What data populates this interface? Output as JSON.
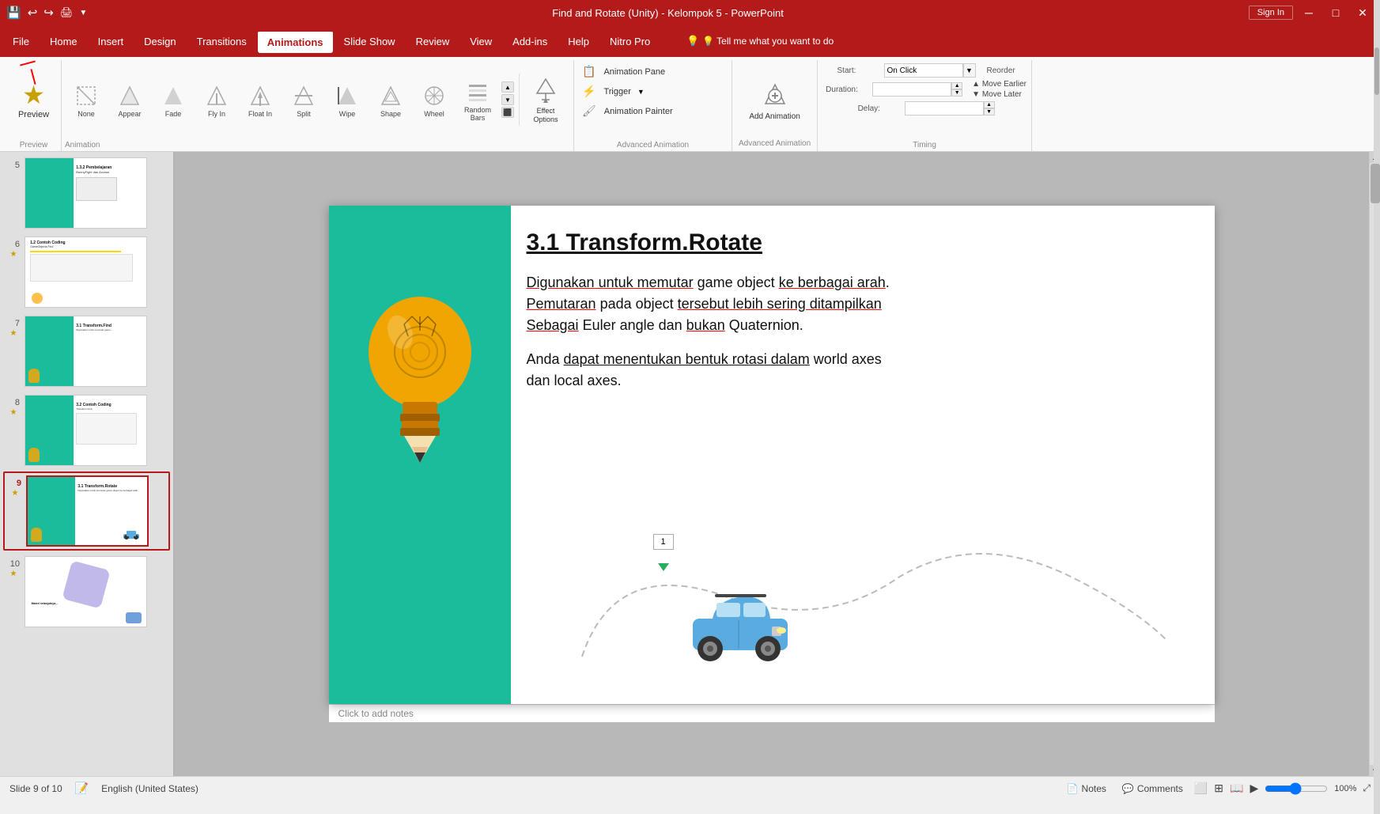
{
  "titlebar": {
    "title": "Find and Rotate (Unity) - Kelompok 5 - PowerPoint",
    "sign_in": "Sign In",
    "quickaccess": [
      "💾",
      "↩",
      "↪",
      "🖨",
      "▼"
    ]
  },
  "menubar": {
    "items": [
      {
        "label": "File",
        "active": false
      },
      {
        "label": "Home",
        "active": false
      },
      {
        "label": "Insert",
        "active": false
      },
      {
        "label": "Design",
        "active": false
      },
      {
        "label": "Transitions",
        "active": false
      },
      {
        "label": "Animations",
        "active": true
      },
      {
        "label": "Slide Show",
        "active": false
      },
      {
        "label": "Review",
        "active": false
      },
      {
        "label": "View",
        "active": false
      },
      {
        "label": "Add-ins",
        "active": false
      },
      {
        "label": "Help",
        "active": false
      },
      {
        "label": "Nitro Pro",
        "active": false
      },
      {
        "label": "💡 Tell me what you want to do",
        "active": false
      }
    ]
  },
  "ribbon": {
    "preview_label": "Preview",
    "animation_group_label": "Animation",
    "advanced_group_label": "Advanced Animation",
    "timing_group_label": "Timing",
    "animations": [
      {
        "label": "None",
        "icon": "✦"
      },
      {
        "label": "Appear",
        "icon": "✦"
      },
      {
        "label": "Fade",
        "icon": "✦"
      },
      {
        "label": "Fly In",
        "icon": "✦"
      },
      {
        "label": "Float In",
        "icon": "✦"
      },
      {
        "label": "Split",
        "icon": "✦"
      },
      {
        "label": "Wipe",
        "icon": "✦"
      },
      {
        "label": "Shape",
        "icon": "✦"
      },
      {
        "label": "Wheel",
        "icon": "✦"
      },
      {
        "label": "Random Bars",
        "icon": "✦"
      }
    ],
    "effect_options": "Effect Options",
    "add_animation": "Add Animation",
    "animation_pane": "Animation Pane",
    "trigger": "Trigger",
    "animation_painter": "Animation Painter",
    "timing": {
      "start_label": "Start:",
      "start_value": "On Click",
      "duration_label": "Duration:",
      "duration_value": "",
      "delay_label": "Delay:",
      "delay_value": "",
      "reorder_label": "Reorder"
    }
  },
  "slide_panel": {
    "slides": [
      {
        "num": "5",
        "star": false,
        "has_teal": true,
        "title": "1.3.2 Pembelajaran: BunnyFight dan Acces"
      },
      {
        "num": "6",
        "star": true,
        "has_teal": false,
        "title": "1.2 Contoh Coding: GameObjects Find"
      },
      {
        "num": "7",
        "star": true,
        "has_teal": true,
        "title": "3.1 Transform.Find"
      },
      {
        "num": "8",
        "star": true,
        "has_teal": true,
        "title": "3.2 Contoh Coding: Transform.Find"
      },
      {
        "num": "9",
        "star": true,
        "has_teal": true,
        "active": true,
        "title": "3.1 Transform.Rotate"
      },
      {
        "num": "10",
        "star": true,
        "has_teal": false,
        "title": "Materi..."
      }
    ]
  },
  "slide": {
    "title": "3.1 Transform.Rotate",
    "body_line1": "Digunakan untuk memutar game object ke berbagai arah.",
    "body_line2": "Pemutaran pada object tersebut lebih sering ditampilkan",
    "body_line3": "Sebagai Euler angle dan bukan Quaternion.",
    "body_line4": "Anda dapat menentukan bentuk rotasi dalam world axes",
    "body_line5": "dan local axes.",
    "animation_number": "1",
    "click_to_add_notes": "Click to add notes"
  },
  "statusbar": {
    "slide_info": "Slide 9 of 10",
    "language": "English (United States)",
    "notes_label": "Notes",
    "comments_label": "Comments"
  }
}
